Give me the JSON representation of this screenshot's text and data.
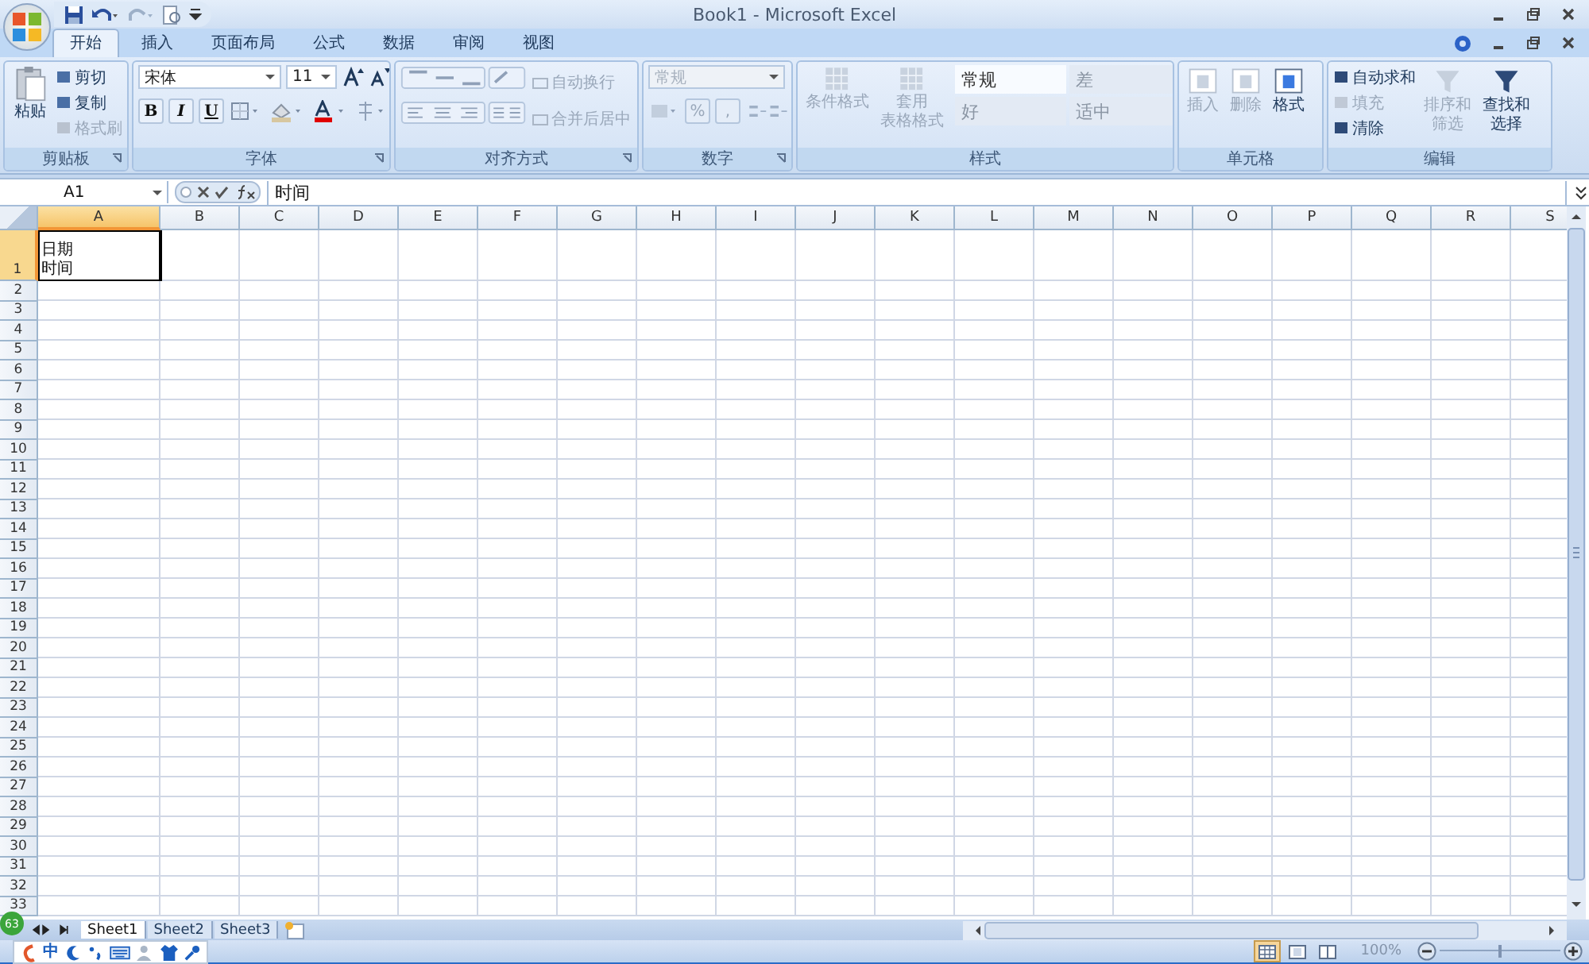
{
  "window": {
    "title": "Book1 - Microsoft Excel"
  },
  "tabs": [
    {
      "label": "开始",
      "selected": true
    },
    {
      "label": "插入",
      "selected": false
    },
    {
      "label": "页面布局",
      "selected": false
    },
    {
      "label": "公式",
      "selected": false
    },
    {
      "label": "数据",
      "selected": false
    },
    {
      "label": "审阅",
      "selected": false
    },
    {
      "label": "视图",
      "selected": false
    }
  ],
  "ribbon": {
    "clipboard": {
      "title": "剪贴板",
      "paste": {
        "label": "粘贴",
        "disabled": false
      },
      "actions": [
        {
          "label": "剪切",
          "disabled": false
        },
        {
          "label": "复制",
          "disabled": false
        },
        {
          "label": "格式刷",
          "disabled": true
        }
      ]
    },
    "font": {
      "title": "字体",
      "font_name": "宋体",
      "font_size": "11",
      "styles": [
        {
          "label": "B",
          "disabled": false
        },
        {
          "label": "I",
          "disabled": false
        },
        {
          "label": "U",
          "disabled": false
        }
      ]
    },
    "alignment": {
      "title": "对齐方式",
      "actions": [
        {
          "label": "自动换行",
          "disabled": true
        },
        {
          "label": "合并后居中",
          "disabled": true
        }
      ]
    },
    "number": {
      "title": "数字",
      "format": {
        "value": "常规",
        "disabled": true
      },
      "buttons": [
        {
          "label": "%",
          "disabled": true
        },
        {
          "label": ",",
          "disabled": true
        }
      ]
    },
    "styles": {
      "title": "样式",
      "actions": [
        {
          "lines": [
            "条件格式"
          ],
          "disabled": true
        },
        {
          "lines": [
            "套用",
            "表格格式"
          ],
          "disabled": true
        }
      ],
      "gallery": [
        {
          "label": "常规",
          "selected": true
        },
        {
          "label": "差",
          "selected": false
        },
        {
          "label": "好",
          "selected": false
        },
        {
          "label": "适中",
          "selected": false
        }
      ]
    },
    "cells": {
      "title": "单元格",
      "actions": [
        {
          "label": "插入",
          "disabled": true
        },
        {
          "label": "删除",
          "disabled": true
        },
        {
          "label": "格式",
          "disabled": false
        }
      ]
    },
    "editing": {
      "title": "编辑",
      "actions": [
        {
          "label": "自动求和",
          "disabled": false
        },
        {
          "label": "填充",
          "disabled": true
        },
        {
          "label": "清除",
          "disabled": false
        }
      ],
      "big": [
        {
          "lines": [
            "排序和",
            "筛选"
          ],
          "disabled": true
        },
        {
          "lines": [
            "查找和",
            "选择"
          ],
          "disabled": false
        }
      ]
    }
  },
  "formula_bar": {
    "name_box": "A1",
    "content": "时间"
  },
  "sheet": {
    "columns": [
      {
        "label": "A",
        "selected": true
      },
      {
        "label": "B",
        "selected": false
      },
      {
        "label": "C",
        "selected": false
      },
      {
        "label": "D",
        "selected": false
      },
      {
        "label": "E",
        "selected": false
      },
      {
        "label": "F",
        "selected": false
      },
      {
        "label": "G",
        "selected": false
      },
      {
        "label": "H",
        "selected": false
      },
      {
        "label": "I",
        "selected": false
      },
      {
        "label": "J",
        "selected": false
      },
      {
        "label": "K",
        "selected": false
      },
      {
        "label": "L",
        "selected": false
      },
      {
        "label": "M",
        "selected": false
      },
      {
        "label": "N",
        "selected": false
      },
      {
        "label": "O",
        "selected": false
      },
      {
        "label": "P",
        "selected": false
      },
      {
        "label": "Q",
        "selected": false
      },
      {
        "label": "R",
        "selected": false
      },
      {
        "label": "S",
        "selected": false
      }
    ],
    "rows": [
      {
        "label": "1",
        "selected": true,
        "cell_a": [
          "日期",
          "时间"
        ]
      },
      {
        "label": "2",
        "selected": false
      },
      {
        "label": "3",
        "selected": false
      },
      {
        "label": "4",
        "selected": false
      },
      {
        "label": "5",
        "selected": false
      },
      {
        "label": "6",
        "selected": false
      },
      {
        "label": "7",
        "selected": false
      },
      {
        "label": "8",
        "selected": false
      },
      {
        "label": "9",
        "selected": false
      },
      {
        "label": "10",
        "selected": false
      },
      {
        "label": "11",
        "selected": false
      },
      {
        "label": "12",
        "selected": false
      },
      {
        "label": "13",
        "selected": false
      },
      {
        "label": "14",
        "selected": false
      },
      {
        "label": "15",
        "selected": false
      },
      {
        "label": "16",
        "selected": false
      },
      {
        "label": "17",
        "selected": false
      },
      {
        "label": "18",
        "selected": false
      },
      {
        "label": "19",
        "selected": false
      },
      {
        "label": "20",
        "selected": false
      },
      {
        "label": "21",
        "selected": false
      },
      {
        "label": "22",
        "selected": false
      },
      {
        "label": "23",
        "selected": false
      },
      {
        "label": "24",
        "selected": false
      },
      {
        "label": "25",
        "selected": false
      },
      {
        "label": "26",
        "selected": false
      },
      {
        "label": "27",
        "selected": false
      },
      {
        "label": "28",
        "selected": false
      },
      {
        "label": "29",
        "selected": false
      },
      {
        "label": "30",
        "selected": false
      },
      {
        "label": "31",
        "selected": false
      },
      {
        "label": "32",
        "selected": false
      },
      {
        "label": "33",
        "selected": false
      }
    ]
  },
  "sheet_tabs": [
    {
      "label": "Sheet1",
      "selected": true
    },
    {
      "label": "Sheet2",
      "selected": false
    },
    {
      "label": "Sheet3",
      "selected": false
    }
  ],
  "status_bar": {
    "views": [
      {
        "kind": "normal",
        "selected": true
      },
      {
        "kind": "page_layout",
        "selected": false
      },
      {
        "kind": "page_break",
        "selected": false
      }
    ],
    "zoom": "100%",
    "zoom_slider": {
      "level": 0.5
    }
  },
  "ime_toolbar": {
    "badge": "63",
    "mode": "中"
  }
}
